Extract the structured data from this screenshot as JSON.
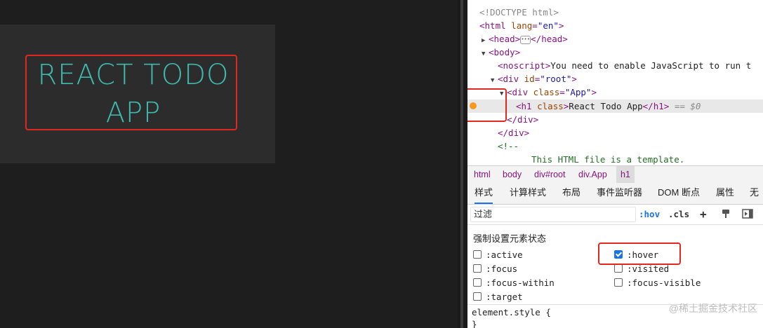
{
  "app": {
    "title_line1": "REACT TODO",
    "title_line2": "APP"
  },
  "elements_tree": {
    "doctype": "<!DOCTYPE html>",
    "html_tag": "html",
    "html_lang_attr": "lang",
    "html_lang_value": "\"en\"",
    "head_open": "<head>",
    "head_close": "</head>",
    "body_open": "<body>",
    "noscript_text": "You need to enable JavaScript to run t",
    "noscript_open": "<noscript>",
    "div_root_tag": "div",
    "div_root_attr": "id",
    "div_root_value": "\"root\"",
    "div_app_tag": "div",
    "div_app_attr": "class",
    "div_app_value": "\"App\"",
    "h1_tag": "h1",
    "h1_attr": "class",
    "h1_text": "React Todo App",
    "h1_close": "</h1>",
    "selected_marker": "== $0",
    "div_close": "</div>",
    "comment_open": "<!--",
    "comment_text": "This HTML file is a template."
  },
  "breadcrumbs": [
    "html",
    "body",
    "div#root",
    "div.App",
    "h1"
  ],
  "tabs": [
    "样式",
    "计算样式",
    "布局",
    "事件监听器",
    "DOM 断点",
    "属性",
    "无障"
  ],
  "filter": {
    "placeholder": "过滤",
    "hov_label": ":hov",
    "cls_label": ".cls",
    "plus_label": "+"
  },
  "states": {
    "title": "强制设置元素状态",
    "items": [
      {
        "label": ":active",
        "checked": false
      },
      {
        "label": ":hover",
        "checked": true
      },
      {
        "label": ":focus",
        "checked": false
      },
      {
        "label": ":visited",
        "checked": false
      },
      {
        "label": ":focus-within",
        "checked": false
      },
      {
        "label": ":focus-visible",
        "checked": false
      },
      {
        "label": ":target",
        "checked": false
      }
    ]
  },
  "element_style": {
    "line1": "element.style {",
    "line2": "}"
  },
  "watermark": "@稀土掘金技术社区",
  "colors": {
    "app_bg": "#1e1e1e",
    "card_bg": "#2c2c2c",
    "title_color": "#3fb9ad",
    "highlight_red": "#e0281e",
    "tag_color": "#881280",
    "attr_name": "#994500",
    "attr_value": "#1a1aa6",
    "accent_blue": "#1a73e8"
  }
}
